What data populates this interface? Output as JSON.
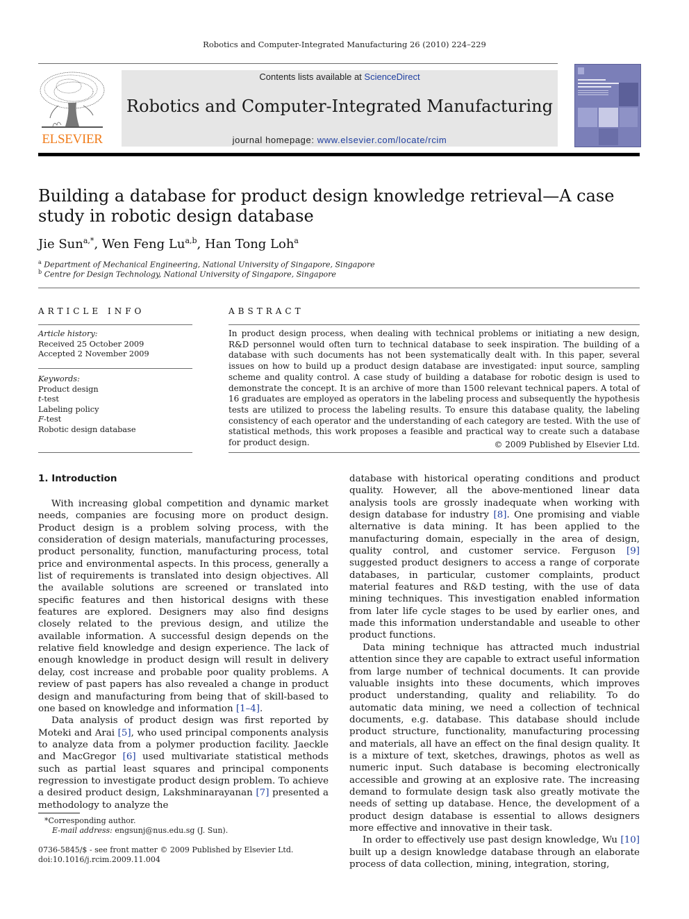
{
  "running_head": "Robotics and Computer-Integrated Manufacturing 26 (2010) 224–229",
  "header": {
    "publisher_logo": "ELSEVIER",
    "contents_prefix": "Contents lists available at ",
    "contents_link": "ScienceDirect",
    "journal_title": "Robotics and Computer-Integrated Manufacturing",
    "homepage_prefix": "journal homepage: ",
    "homepage_link": "www.elsevier.com/locate/rcim",
    "cover_image": "journal-cover-thumbnail"
  },
  "article": {
    "title": "Building a database for product design knowledge retrieval—A case study in robotic design database",
    "authors": [
      {
        "name": "Jie Sun",
        "sup": "a,*"
      },
      {
        "name": "Wen Feng Lu",
        "sup": "a,b"
      },
      {
        "name": "Han Tong Loh",
        "sup": "a"
      }
    ],
    "affiliations": [
      {
        "mark": "a",
        "text": "Department of Mechanical Engineering, National University of Singapore, Singapore"
      },
      {
        "mark": "b",
        "text": "Centre for Design Technology, National University of Singapore, Singapore"
      }
    ]
  },
  "article_info": {
    "heading": "ARTICLE INFO",
    "history_label": "Article history:",
    "received": "Received 25 October 2009",
    "accepted": "Accepted 2 November 2009",
    "keywords_label": "Keywords:",
    "keywords": [
      {
        "italic": "",
        "text": "Product design"
      },
      {
        "italic": "t",
        "text": "-test"
      },
      {
        "italic": "",
        "text": "Labeling policy"
      },
      {
        "italic": "F",
        "text": "-test"
      },
      {
        "italic": "",
        "text": "Robotic design database"
      }
    ]
  },
  "abstract": {
    "heading": "ABSTRACT",
    "text": "In product design process, when dealing with technical problems or initiating a new design, R&D personnel would often turn to technical database to seek inspiration. The building of a database with such documents has not been systematically dealt with. In this paper, several issues on how to build up a product design database are investigated: input source, sampling scheme and quality control. A case study of building a database for robotic design is used to demonstrate the concept. It is an archive of more than 1500 relevant technical papers. A total of 16 graduates are employed as operators in the labeling process and subsequently the hypothesis tests are utilized to process the labeling results. To ensure this database quality, the labeling consistency of each operator and the understanding of each category are tested. With the use of statistical methods, this work proposes a feasible and practical way to create such a database for product design.",
    "copyright": "© 2009 Published by Elsevier Ltd."
  },
  "body": {
    "section_heading": "1.  Introduction",
    "left": {
      "p1": "With increasing global competition and dynamic market needs, companies are focusing more on product design. Product design is a problem solving process, with the consideration of design materials, manufacturing processes, product personality, function, manufacturing process, total price and environmental aspects. In this process, generally a list of requirements is translated into design objectives. All the available solutions are screened or translated into specific features and then historical designs with these features are explored. Designers may also find designs closely related to the previous design, and utilize the available information. A successful design depends on the relative field knowledge and design experience. The lack of enough knowledge in product design will result in delivery delay, cost increase and probable poor quality problems. A review of past papers has also revealed a change in product design and manufacturing from being that of skill-based to one based on knowledge and information ",
      "p1_ref": "[1–4]",
      "p1_end": ".",
      "p2_a": "Data analysis of product design was first reported by Moteki and Arai ",
      "p2_ref1": "[5]",
      "p2_b": ", who used principal components analysis to analyze data from a polymer production facility. Jaeckle and MacGregor ",
      "p2_ref2": "[6]",
      "p2_c": " used multivariate statistical methods such as partial least squares and principal components regression to investigate product design problem. To achieve a desired product design, Lakshminarayanan ",
      "p2_ref3": "[7]",
      "p2_d": " presented a methodology to analyze the"
    },
    "right": {
      "p1_a": "database with historical operating conditions and product quality. However, all the above-mentioned linear data analysis tools are grossly inadequate when working with design database for industry ",
      "p1_ref1": "[8]",
      "p1_b": ". One promising and viable alternative is data mining. It has been applied to the manufacturing domain, especially in the area of design, quality control, and customer service. Ferguson ",
      "p1_ref2": "[9]",
      "p1_c": " suggested product designers to access a range of corporate databases, in particular, customer complaints, product material features and R&D testing, with the use of data mining techniques. This investigation enabled information from later life cycle stages to be used by earlier ones, and made this information understandable and useable to other product functions.",
      "p2": "Data mining technique has attracted much industrial attention since they are capable to extract useful information from large number of technical documents. It can provide valuable insights into these documents, which improves product understanding, quality and reliability. To do automatic data mining, we need a collection of technical documents, e.g. database. This database should include product structure, functionality, manufacturing processing and materials, all have an effect on the final design quality. It is a mixture of text, sketches, drawings, photos as well as numeric input. Such database is becoming electronically accessible and growing at an explosive rate. The increasing demand to formulate design task also greatly motivate the needs of setting up database. Hence, the development of a product design database is essential to allows designers more effective and innovative in their task.",
      "p3_a": "In order to effectively use past design knowledge, Wu ",
      "p3_ref": "[10]",
      "p3_b": " built up a design knowledge database through an elaborate process of data collection, mining, integration, storing,"
    }
  },
  "footnote": {
    "mark": "*",
    "corresponding": "Corresponding author.",
    "email_label": "E-mail address:",
    "email": "engsunj@nus.edu.sg",
    "email_suffix": " (J. Sun)."
  },
  "front_matter": {
    "issn_line": "0736-5845/$ - see front matter © 2009 Published by Elsevier Ltd.",
    "doi": "doi:10.1016/j.rcim.2009.11.004"
  },
  "colors": {
    "link": "#1f3fa0",
    "elsevier_orange": "#f07c1a",
    "banner_bg": "#e6e6e6",
    "cover_bg": "#7b7fb8"
  }
}
